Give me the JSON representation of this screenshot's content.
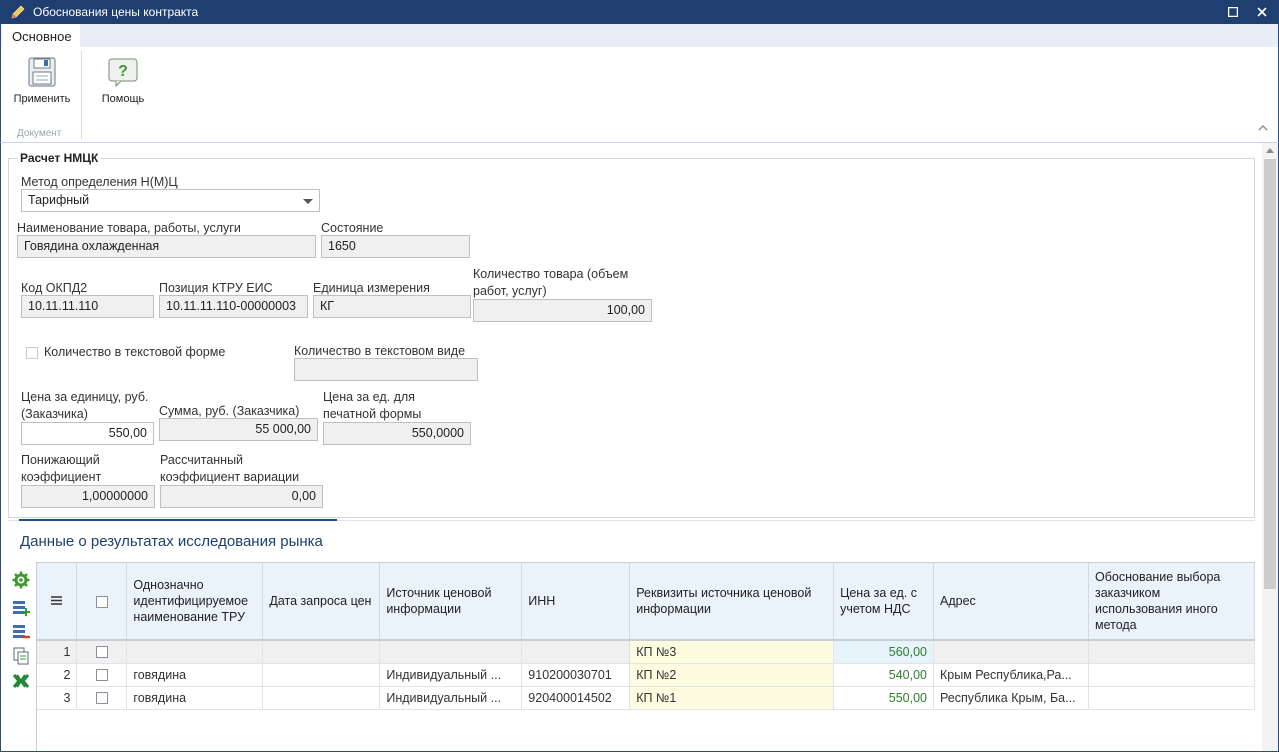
{
  "window": {
    "title": "Обоснования цены контракта"
  },
  "ribbon": {
    "tab": "Основное",
    "apply_label": "Применить",
    "help_label": "Помощь",
    "group_label": "Документ"
  },
  "form": {
    "legend": "Расчет НМЦК",
    "method_label": "Метод определения Н(М)Ц",
    "method_value": "Тарифный",
    "product_name_label": "Наименование товара, работы, услуги",
    "product_name_value": "Говядина охлажденная",
    "state_label": "Состояние",
    "state_value": "1650",
    "okpd_label": "Код ОКПД2",
    "okpd_value": "10.11.11.110",
    "ktru_label": "Позиция КТРУ ЕИС",
    "ktru_value": "10.11.11.110-00000003",
    "unit_label": "Единица измерения",
    "unit_value": "КГ",
    "quantity_label": "Количество товара (объем работ, услуг)",
    "quantity_value": "100,00",
    "qty_text_checkbox_label": "Количество в текстовой форме",
    "qty_text_label": "Количество в текстовом виде",
    "qty_text_value": "",
    "unit_price_label": "Цена за единицу, руб. (Заказчика)",
    "unit_price_value": "550,00",
    "sum_label": "Сумма, руб. (Заказчика)",
    "sum_value": "55 000,00",
    "print_price_label": "Цена за ед. для печатной формы",
    "print_price_value": "550,0000",
    "reduce_coef_label": "Понижающий коэффициент",
    "reduce_coef_value": "1,00000000",
    "variation_label": "Рассчитанный коэффициент вариации",
    "variation_value": "0,00"
  },
  "market": {
    "title": "Данные о результатах исследования рынка",
    "columns": [
      "Однозначно идентифицируемое наименование ТРУ",
      "Дата запроса цен",
      "Источник ценовой информации",
      "ИНН",
      "Реквизиты источника ценовой информации",
      "Цена за ед. с учетом НДС",
      "Адрес",
      "Обоснование выбора заказчиком использования иного метода"
    ],
    "rows": [
      {
        "n": "1",
        "name": "",
        "date": "",
        "source": "",
        "inn": "",
        "req": "КП №3",
        "price": "560,00",
        "addr": "",
        "reason": ""
      },
      {
        "n": "2",
        "name": "говядина",
        "date": "",
        "source": "Индивидуальный ...",
        "inn": "910200030701",
        "req": "КП №2",
        "price": "540,00",
        "addr": "Крым Республика,Ра...",
        "reason": ""
      },
      {
        "n": "3",
        "name": "говядина",
        "date": "",
        "source": "Индивидуальный ...",
        "inn": "920400014502",
        "req": "КП №1",
        "price": "550,00",
        "addr": "Республика Крым, Ба...",
        "reason": ""
      }
    ]
  }
}
